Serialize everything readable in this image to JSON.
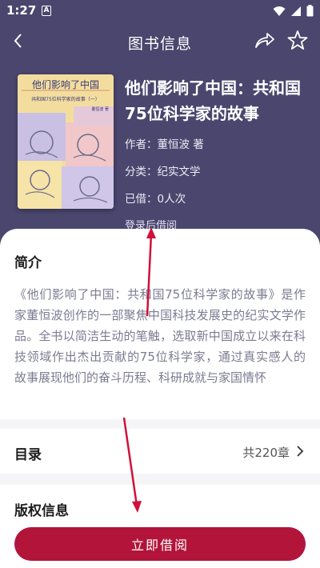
{
  "status_bar": {
    "time": "1:27",
    "notification_badge": "A"
  },
  "navbar": {
    "title": "图书信息"
  },
  "book": {
    "title": "他们影响了中国：共和国75位科学家的故事",
    "author": "作者：董恒波 著",
    "category": "分类：纪实文学",
    "borrowed": "已借：0人次",
    "login_hint": "登录后借阅",
    "cover": {
      "title": "他们影响了中国",
      "subtitle": "共和国75位科学家的故事（一）",
      "author": "董恒波 著"
    }
  },
  "intro": {
    "heading": "简介",
    "text": "《他们影响了中国：共和国75位科学家的故事》是作家董恒波创作的一部聚焦中国科技发展史的纪实文学作品。全书以简洁生动的笔触，选取新中国成立以来在科技领域作出杰出贡献的75位科学家，通过真实感人的故事展现他们的奋斗历程、科研成就与家国情怀"
  },
  "toc": {
    "heading": "目录",
    "count": "共220章"
  },
  "copyright": {
    "heading": "版权信息"
  },
  "actions": {
    "borrow_label": "立即借阅"
  },
  "colors": {
    "header_bg": "#4a466e",
    "accent": "#b3143a",
    "annotation_arrow": "#d0103a"
  },
  "icons": [
    "back-icon",
    "share-icon",
    "star-icon",
    "chevron-right-icon",
    "wifi-icon",
    "signal-icon",
    "battery-icon"
  ]
}
